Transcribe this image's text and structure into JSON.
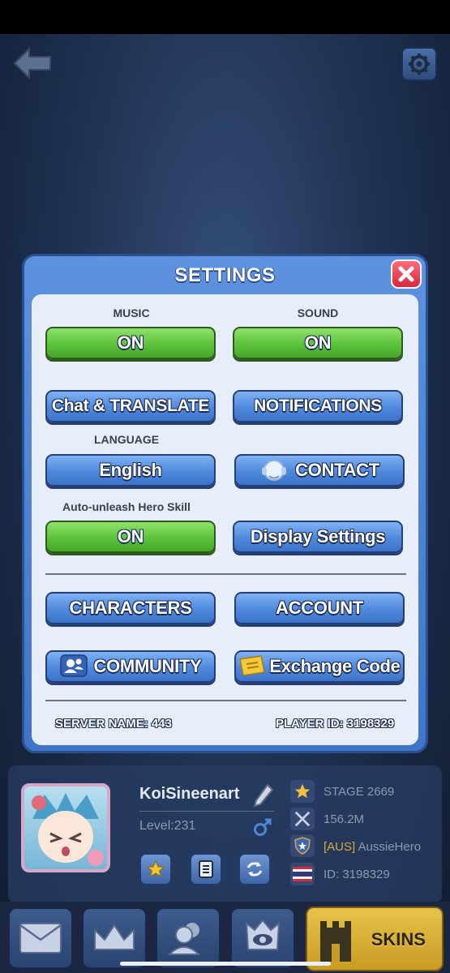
{
  "settings": {
    "title": "SETTINGS",
    "music_label": "MUSIC",
    "music_value": "ON",
    "sound_label": "SOUND",
    "sound_value": "ON",
    "chat_translate": "Chat & TRANSLATE",
    "notifications": "NOTIFICATIONS",
    "language_label": "LANGUAGE",
    "language_value": "English",
    "contact": "CONTACT",
    "auto_unleash_label": "Auto-unleash Hero Skill",
    "auto_unleash_value": "ON",
    "display_settings": "Display Settings",
    "characters": "CHARACTERS",
    "account": "ACCOUNT",
    "community": "COMMUNITY",
    "exchange_code": "Exchange Code",
    "server_name": "SERVER NAME: 443",
    "player_id": "PLAYER ID: 3198329"
  },
  "profile": {
    "name": "KoiSineenart",
    "level": "Level:231",
    "stage": "STAGE 2669",
    "power": "156.2M",
    "guild_tag": "[AUS]",
    "guild_name": "AussieHero",
    "id": "ID: 3198329"
  },
  "bottom_nav": {
    "skins": "SKINS"
  },
  "colors": {
    "green_button": "#5cc23a",
    "blue_button": "#4f88dc",
    "dialog_border": "#3f74c8",
    "close_red": "#d8263d",
    "skins_gold": "#e7c34a"
  }
}
